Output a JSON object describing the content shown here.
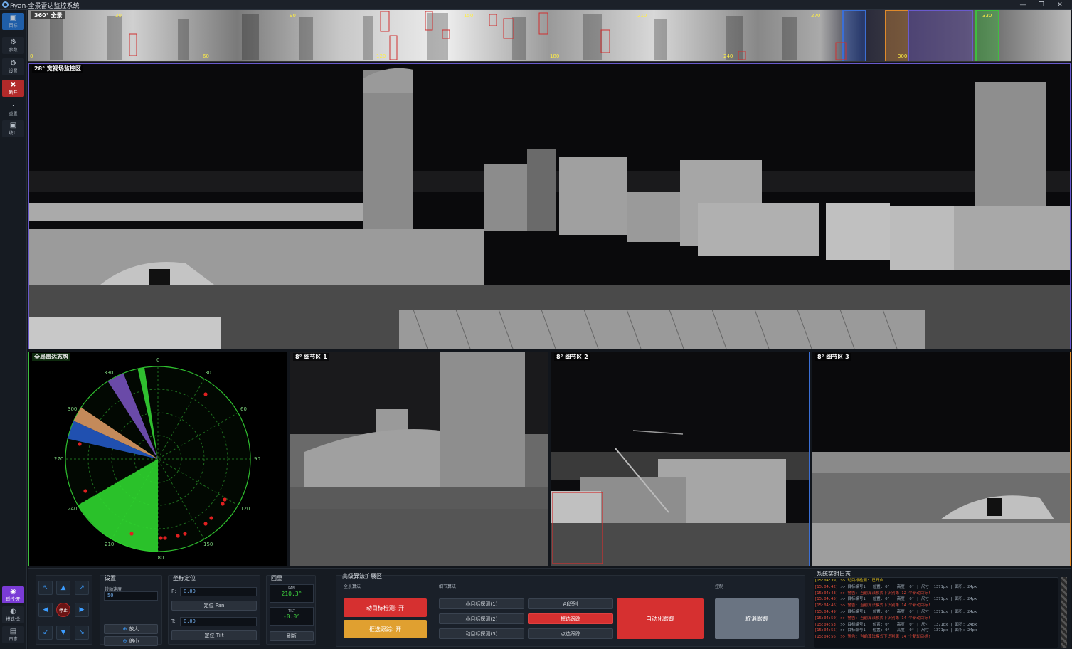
{
  "app": {
    "title": "Ryan-全景雷达监控系统",
    "minimize": "—",
    "maximize": "❐",
    "close": "✕"
  },
  "sidebar": {
    "items": [
      {
        "icon": "▣",
        "label": "目标"
      },
      {
        "icon": "⚙",
        "label": "参数"
      },
      {
        "icon": "⚙",
        "label": "设置"
      },
      {
        "icon": "✖",
        "label": "断开"
      },
      {
        "icon": "·",
        "label": "重置"
      },
      {
        "icon": "▣",
        "label": "统计"
      }
    ],
    "bottom": [
      {
        "icon": "◉",
        "label": "遥控·开"
      },
      {
        "icon": "◐",
        "label": "模式·关"
      },
      {
        "icon": "▤",
        "label": "日志"
      }
    ]
  },
  "panorama": {
    "label": "360° 全景",
    "top_ticks": [
      "30",
      "90",
      "150",
      "210",
      "270",
      "330"
    ],
    "bottom_ticks": [
      "0",
      "60",
      "120",
      "180",
      "240",
      "300"
    ]
  },
  "wide_view": {
    "label": "28° 宽视场监控区"
  },
  "radar": {
    "label": "全局雷达态势",
    "bearings": [
      "0",
      "30",
      "60",
      "90",
      "120",
      "150",
      "180",
      "210",
      "240",
      "270",
      "300",
      "330"
    ]
  },
  "detail_views": [
    {
      "label": "8° 细节区 1",
      "color": "#3fbf3f"
    },
    {
      "label": "8° 细节区 2",
      "color": "#3b6fd6"
    },
    {
      "label": "8° 细节区 3",
      "color": "#e08a2a"
    }
  ],
  "controls": {
    "ptz": {
      "up": "▲",
      "down": "▼",
      "left": "◀",
      "right": "▶",
      "up_left": "↖",
      "up_right": "↗",
      "down_left": "↙",
      "down_right": "↘",
      "stop": "停止"
    },
    "speed": {
      "title": "设置",
      "label": "转动速度",
      "value": "50",
      "zoom_in": "放大",
      "zoom_out": "缩小"
    },
    "coord": {
      "title": "坐标定位",
      "p_label": "P:",
      "p_value": "0.00",
      "p_btn": "定位 Pan",
      "t_label": "T:",
      "t_value": "0.00",
      "t_btn": "定位 Tilt"
    },
    "readout": {
      "title": "回显",
      "pan_label": "PAN",
      "pan_value": "210.3°",
      "tilt_label": "TILT",
      "tilt_value": "-0.0°",
      "refresh": "刷新"
    },
    "algo": {
      "title": "高级算法扩展区",
      "global_title": "全景算法",
      "btn_motion": "动目标检测: 开",
      "btn_box": "框选跟踪: 开",
      "detail_title": "细节算法",
      "btn_small1": "小目标探测(1)",
      "btn_small2": "小目标探测(2)",
      "btn_moving": "动目标探测(3)",
      "btn_ai": "AI识别",
      "btn_frame": "框选跟踪",
      "btn_point": "点选跟踪",
      "btn_auto": "自动化跟踪",
      "act_title": "控制",
      "btn_cancel": "取消跟踪"
    },
    "log": {
      "title": "系统实时日志",
      "rows": [
        {
          "t": "[15:04:39]",
          "m": ">> 动目标检测: 已开启",
          "c": "#e0c020"
        },
        {
          "t": "[15:04:42]",
          "m": ">> 目标编号1 | 位置: 0° | 高度: 0° | 尺寸: 1371px | 面积: 24px",
          "c": "#9aa6b2"
        },
        {
          "t": "[15:04:43]",
          "m": ">> 警告: 当前算法模式下识别第 12 个新动目标!",
          "c": "#e04a3a"
        },
        {
          "t": "[15:04:45]",
          "m": ">> 目标编号1 | 位置: 0° | 高度: 0° | 尺寸: 1371px | 面积: 24px",
          "c": "#9aa6b2"
        },
        {
          "t": "[15:04:46]",
          "m": ">> 警告: 当前算法模式下识别第 14 个新动目标!",
          "c": "#e04a3a"
        },
        {
          "t": "[15:04:49]",
          "m": ">> 目标编号1 | 位置: 0° | 高度: 0° | 尺寸: 1371px | 面积: 24px",
          "c": "#9aa6b2"
        },
        {
          "t": "[15:04:50]",
          "m": ">> 警告: 当前算法模式下识别第 14 个新动目标!",
          "c": "#e04a3a"
        },
        {
          "t": "[15:04:53]",
          "m": ">> 目标编号1 | 位置: 0° | 高度: 0° | 尺寸: 1371px | 面积: 24px",
          "c": "#9aa6b2"
        },
        {
          "t": "[15:04:55]",
          "m": ">> 目标编号1 | 位置: 0° | 高度: 0° | 尺寸: 1371px | 面积: 24px",
          "c": "#9aa6b2"
        },
        {
          "t": "[15:04:56]",
          "m": ">> 警告: 当前算法模式下识别第 14 个新动目标!",
          "c": "#e04a3a"
        }
      ]
    }
  }
}
